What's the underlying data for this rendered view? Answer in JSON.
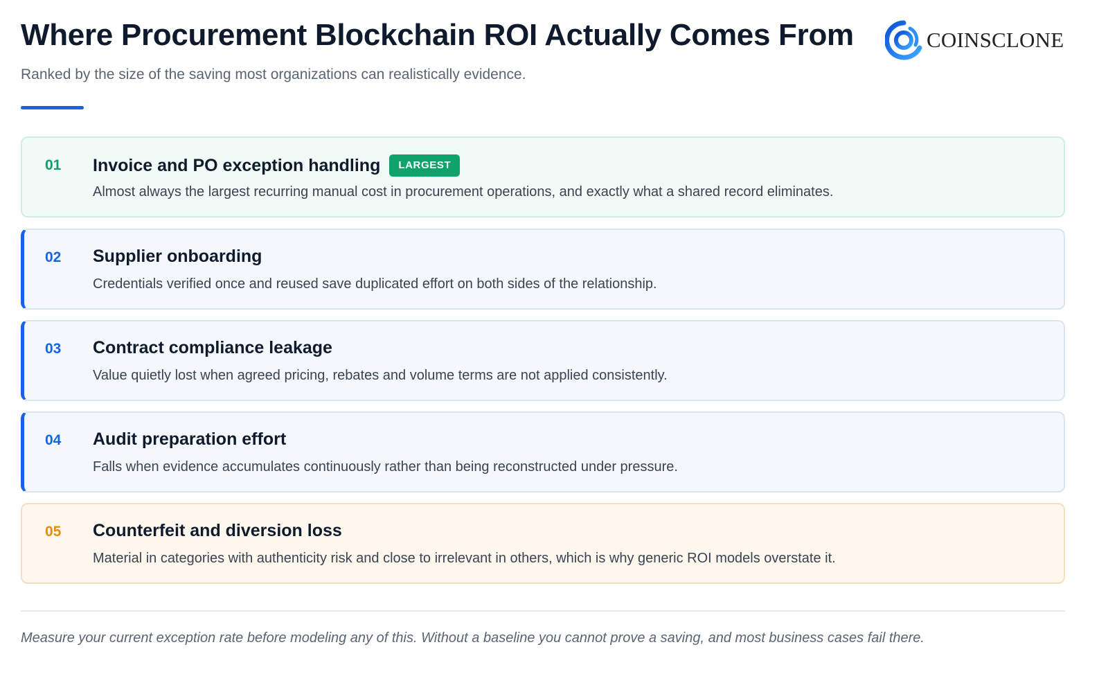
{
  "header": {
    "title": "Where Procurement Blockchain ROI Actually Comes From",
    "subtitle": "Ranked by the size of the saving most organizations can realistically evidence."
  },
  "logo": {
    "text": "COINSCLONE",
    "icon": "coinsclone-logo-icon"
  },
  "colors": {
    "accent": "#1565e0",
    "green": "#0ea36a",
    "amber": "#e08f12"
  },
  "items": [
    {
      "number": "01",
      "title": "Invoice and PO exception handling",
      "badge": "LARGEST",
      "description": "Almost always the largest recurring manual cost in procurement operations, and exactly what a shared record eliminates."
    },
    {
      "number": "02",
      "title": "Supplier onboarding",
      "description": "Credentials verified once and reused save duplicated effort on both sides of the relationship."
    },
    {
      "number": "03",
      "title": "Contract compliance leakage",
      "description": "Value quietly lost when agreed pricing, rebates and volume terms are not applied consistently."
    },
    {
      "number": "04",
      "title": "Audit preparation effort",
      "description": "Falls when evidence accumulates continuously rather than being reconstructed under pressure."
    },
    {
      "number": "05",
      "title": "Counterfeit and diversion loss",
      "description": "Material in categories with authenticity risk and close to irrelevant in others, which is why generic ROI models overstate it."
    }
  ],
  "footer": {
    "note": "Measure your current exception rate before modeling any of this. Without a baseline you cannot prove a saving, and most business cases fail there."
  }
}
